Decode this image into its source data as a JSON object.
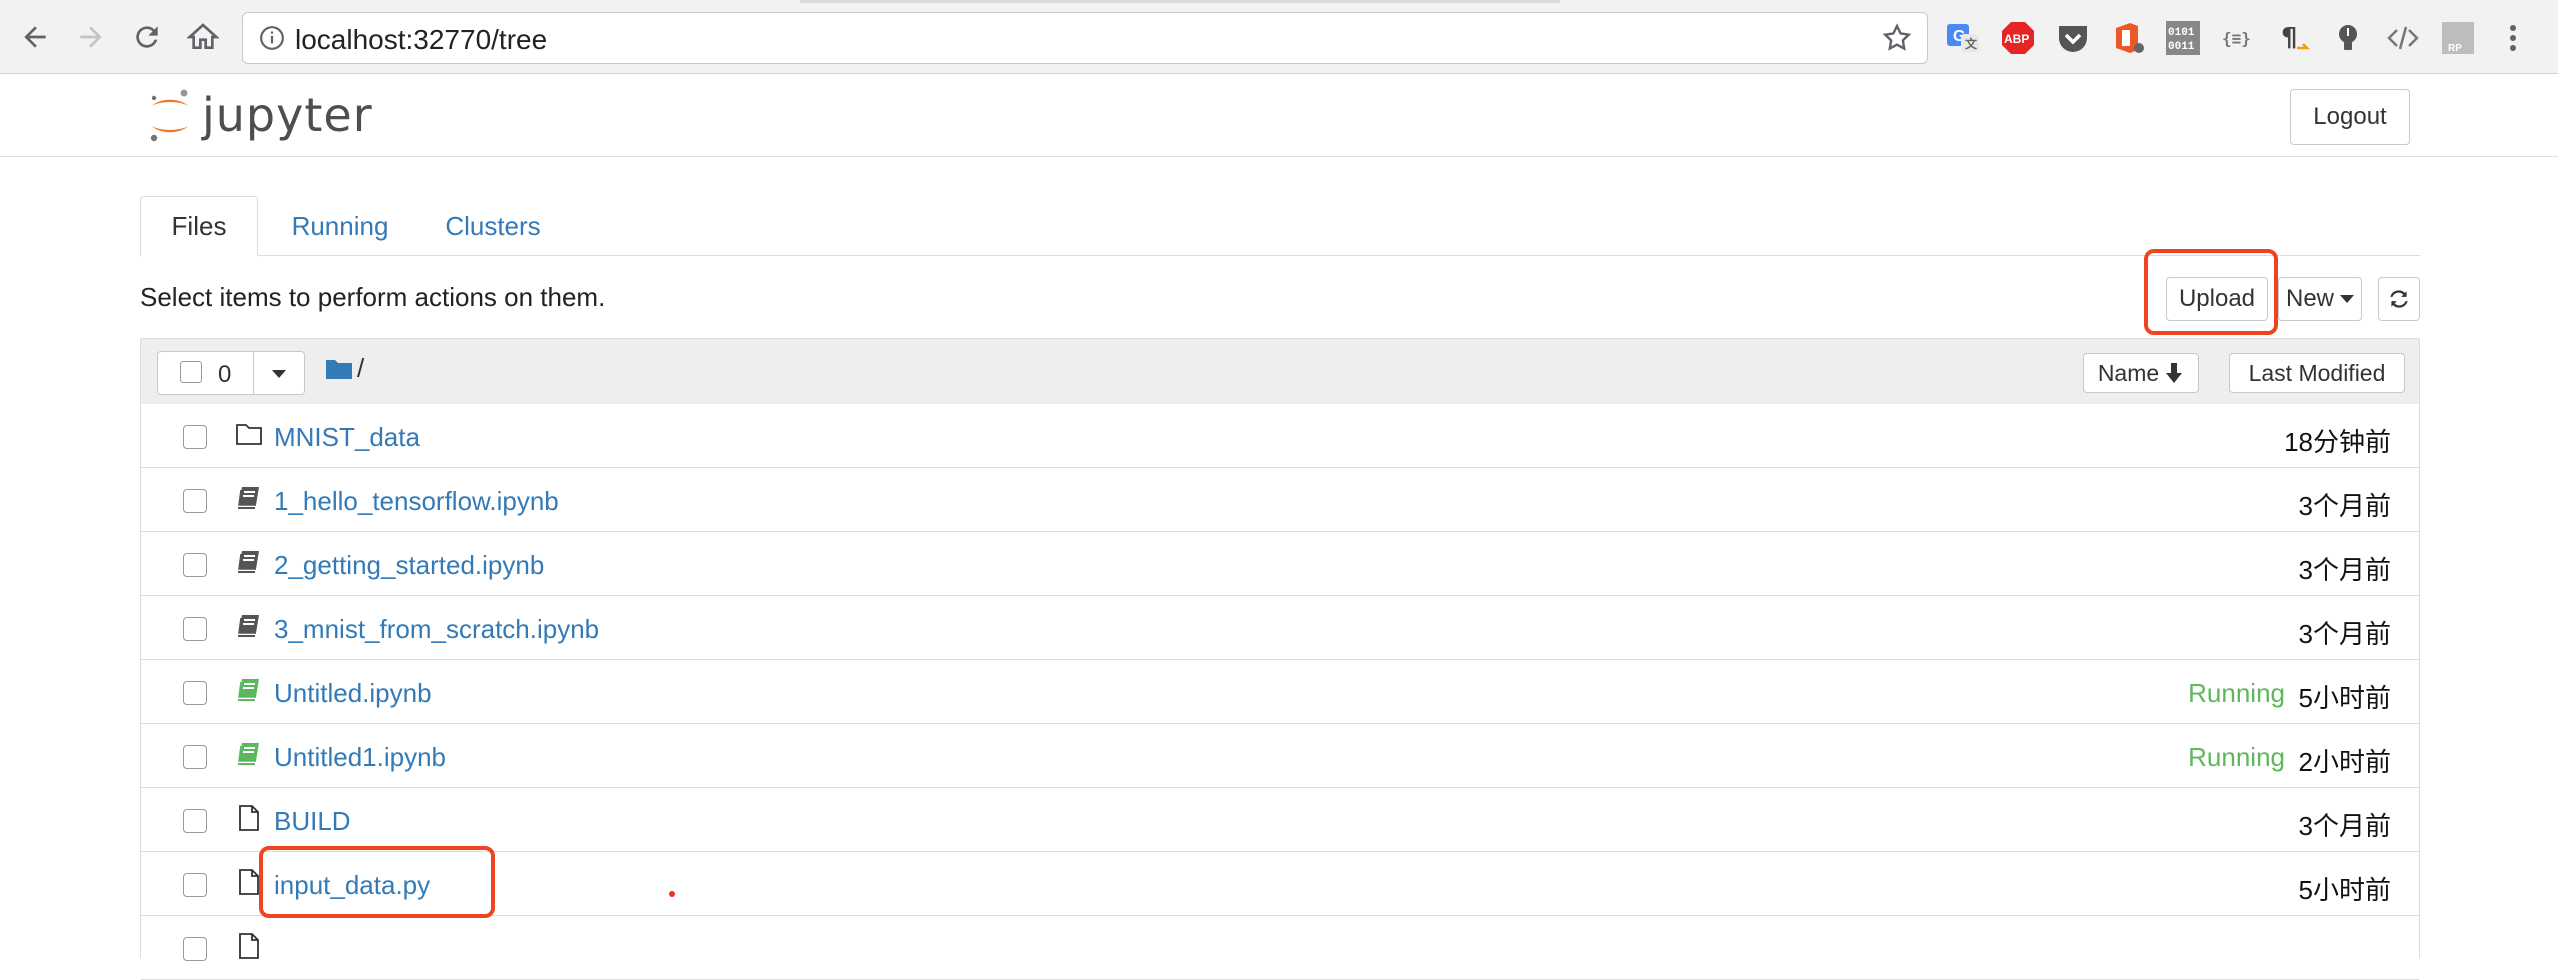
{
  "browser": {
    "url": "localhost:32770/tree",
    "extensions": [
      "google-translate-icon",
      "adblock-icon",
      "pocket-icon",
      "office-icon",
      "binary-icon",
      "json-icon",
      "paragraph-icon",
      "lightbulb-icon",
      "code-icon",
      "rp-icon"
    ],
    "abp_label": "ABP",
    "binary_label": "0101\n0011",
    "json_label": "{≡}",
    "rp_label": "RP"
  },
  "jupyter": {
    "logo_text": "jupyter",
    "logout_label": "Logout",
    "tabs": [
      {
        "label": "Files",
        "active": true
      },
      {
        "label": "Running",
        "active": false
      },
      {
        "label": "Clusters",
        "active": false
      }
    ],
    "hint": "Select items to perform actions on them.",
    "upload_label": "Upload",
    "new_label": "New",
    "selected_count": "0",
    "root_path": "/",
    "sort_name_label": "Name",
    "sort_modified_label": "Last Modified"
  },
  "files": [
    {
      "name": "MNIST_data",
      "type": "folder",
      "status": "",
      "modified": "18分钟前"
    },
    {
      "name": "1_hello_tensorflow.ipynb",
      "type": "notebook",
      "status": "",
      "modified": "3个月前"
    },
    {
      "name": "2_getting_started.ipynb",
      "type": "notebook",
      "status": "",
      "modified": "3个月前"
    },
    {
      "name": "3_mnist_from_scratch.ipynb",
      "type": "notebook",
      "status": "",
      "modified": "3个月前"
    },
    {
      "name": "Untitled.ipynb",
      "type": "notebook-running",
      "status": "Running",
      "modified": "5小时前"
    },
    {
      "name": "Untitled1.ipynb",
      "type": "notebook-running",
      "status": "Running",
      "modified": "2小时前"
    },
    {
      "name": "BUILD",
      "type": "file",
      "status": "",
      "modified": "3个月前"
    },
    {
      "name": "input_data.py",
      "type": "file",
      "status": "",
      "modified": "5小时前"
    },
    {
      "name": "",
      "type": "file",
      "status": "",
      "modified": ""
    }
  ],
  "colors": {
    "link": "#337ab7",
    "running": "#5cb85c",
    "highlight": "#ee4422",
    "jupyter_orange": "#f37626"
  }
}
